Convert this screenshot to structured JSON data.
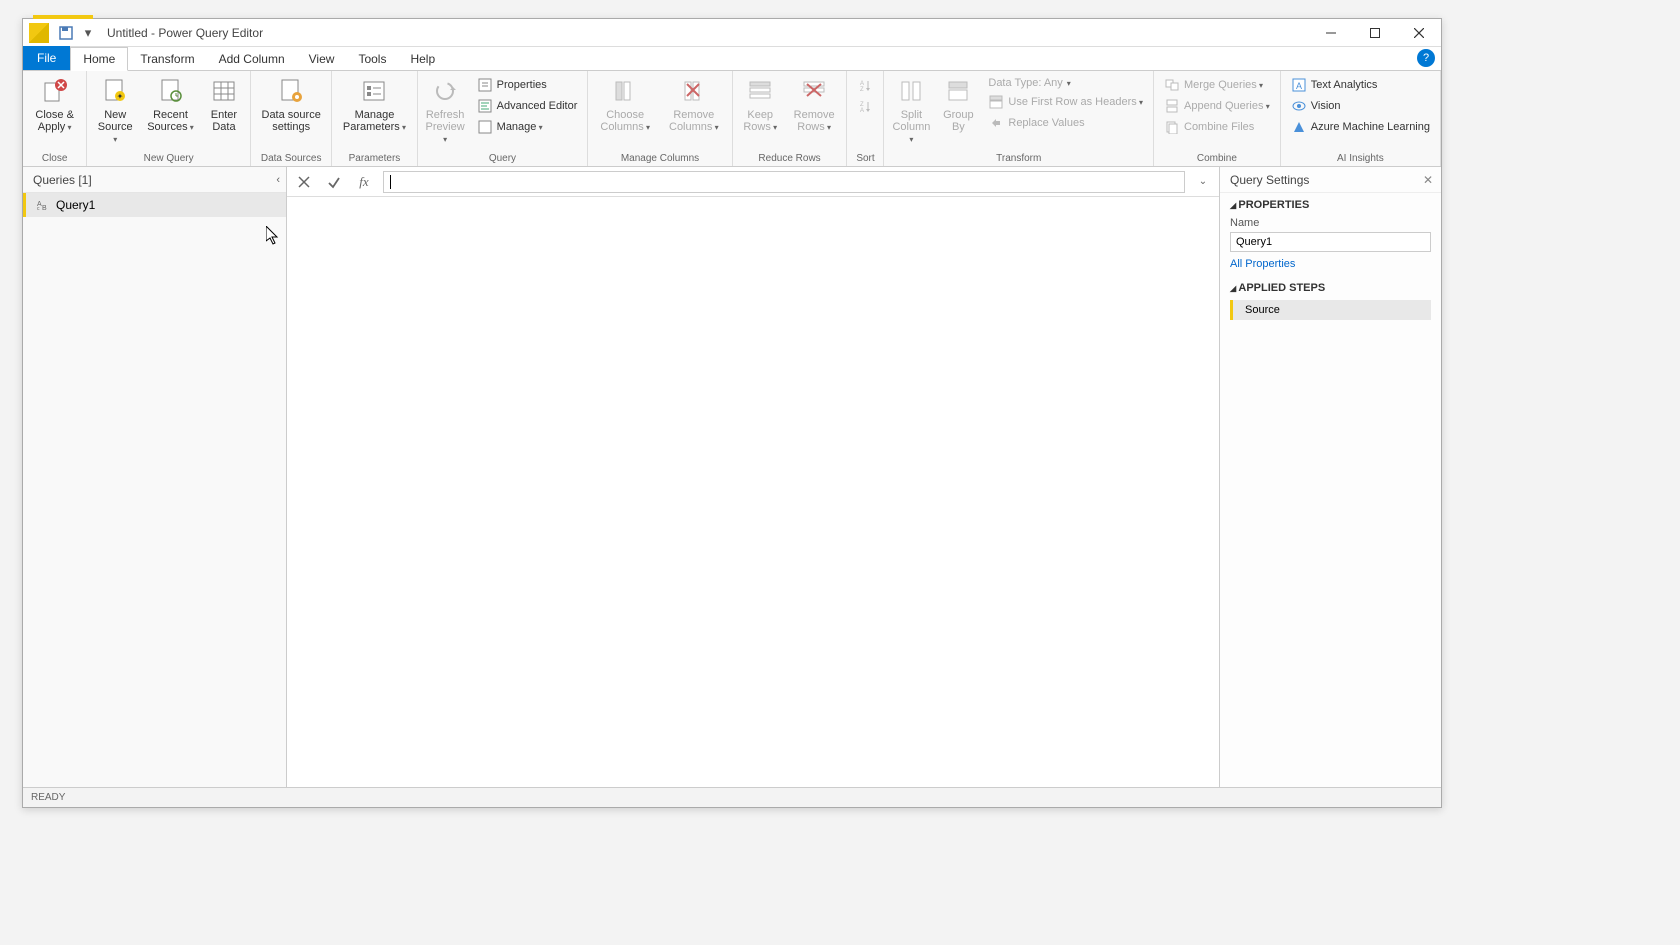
{
  "window": {
    "title": "Untitled - Power Query Editor"
  },
  "tabs": {
    "file": "File",
    "home": "Home",
    "transform": "Transform",
    "add_column": "Add Column",
    "view": "View",
    "tools": "Tools",
    "help": "Help"
  },
  "ribbon": {
    "close_group": "Close",
    "close_apply": "Close & Apply",
    "new_query_group": "New Query",
    "new_source": "New Source",
    "recent_sources": "Recent Sources",
    "enter_data": "Enter Data",
    "data_sources_group": "Data Sources",
    "data_source_settings": "Data source settings",
    "parameters_group": "Parameters",
    "manage_parameters": "Manage Parameters",
    "query_group": "Query",
    "refresh_preview": "Refresh Preview",
    "properties": "Properties",
    "advanced_editor": "Advanced Editor",
    "manage": "Manage",
    "manage_columns_group": "Manage Columns",
    "choose_columns": "Choose Columns",
    "remove_columns": "Remove Columns",
    "reduce_rows_group": "Reduce Rows",
    "keep_rows": "Keep Rows",
    "remove_rows": "Remove Rows",
    "sort_group": "Sort",
    "transform_group": "Transform",
    "split_column": "Split Column",
    "group_by": "Group By",
    "data_type": "Data Type: Any",
    "first_row_headers": "Use First Row as Headers",
    "replace_values": "Replace Values",
    "combine_group": "Combine",
    "merge_queries": "Merge Queries",
    "append_queries": "Append Queries",
    "combine_files": "Combine Files",
    "ai_insights_group": "AI Insights",
    "text_analytics": "Text Analytics",
    "vision": "Vision",
    "azure_ml": "Azure Machine Learning"
  },
  "queries": {
    "header": "Queries [1]",
    "items": [
      {
        "name": "Query1"
      }
    ]
  },
  "formula": {
    "value": ""
  },
  "settings": {
    "header": "Query Settings",
    "properties_title": "PROPERTIES",
    "name_label": "Name",
    "name_value": "Query1",
    "all_properties": "All Properties",
    "applied_steps_title": "APPLIED STEPS",
    "steps": [
      {
        "name": "Source"
      }
    ]
  },
  "status": {
    "ready": "READY"
  }
}
